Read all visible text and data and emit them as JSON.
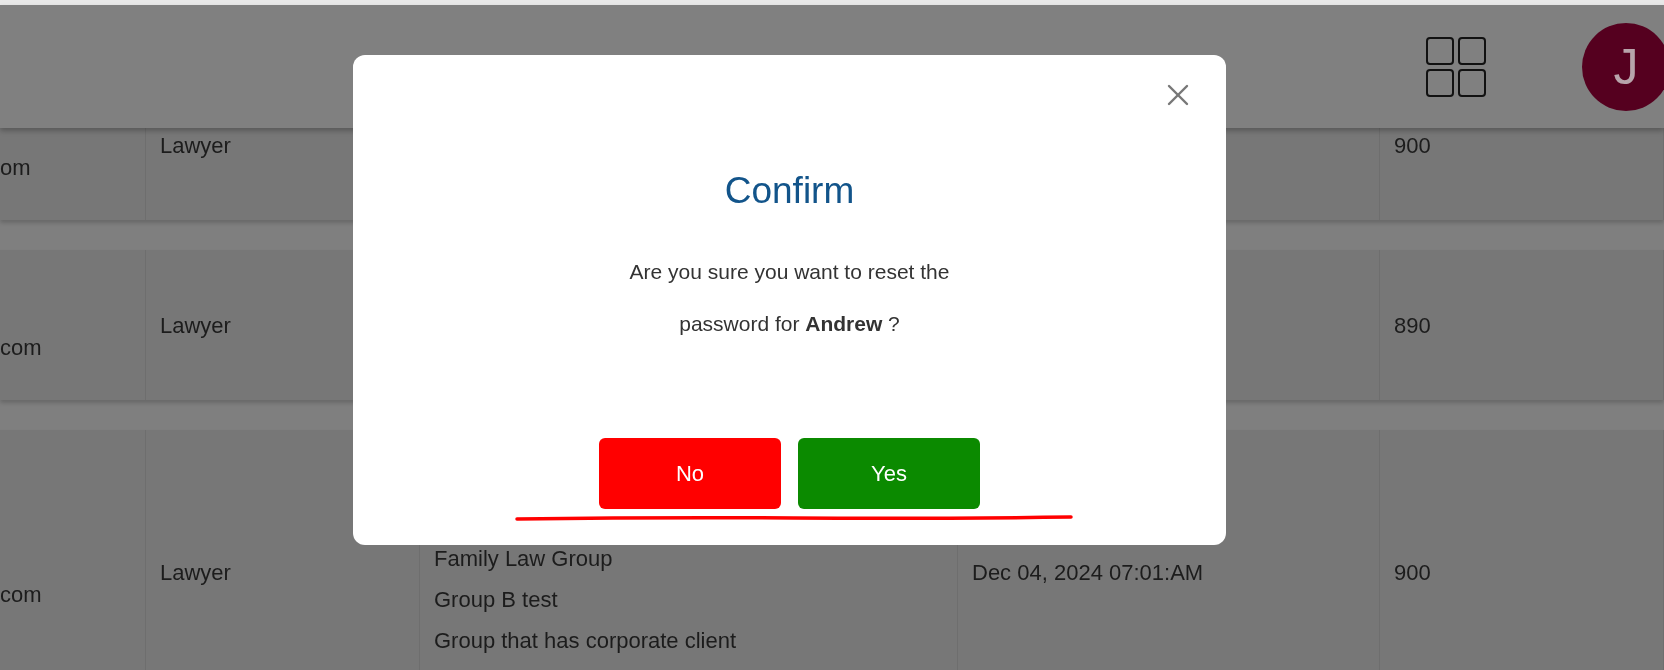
{
  "header": {
    "avatar_letter": "J"
  },
  "table": {
    "rows": [
      {
        "column_1": "om",
        "column_2": "Lawyer",
        "column_5": "900"
      },
      {
        "column_1": "com",
        "column_2": "Lawyer",
        "column_5": "890"
      },
      {
        "column_1": "com",
        "column_2": "Lawyer",
        "column_3": [
          "Family Law Group",
          "Group B test",
          "Group that has corporate client"
        ],
        "column_4": "Dec 04, 2024 07:01:AM",
        "column_5": "900"
      }
    ]
  },
  "dialog": {
    "title": "Confirm",
    "message": "Are you sure you want to reset the password for **Andrew** ?",
    "buttons": [
      {
        "label": "No",
        "kind": "cancel"
      },
      {
        "label": "Yes",
        "kind": "confirm"
      }
    ]
  }
}
